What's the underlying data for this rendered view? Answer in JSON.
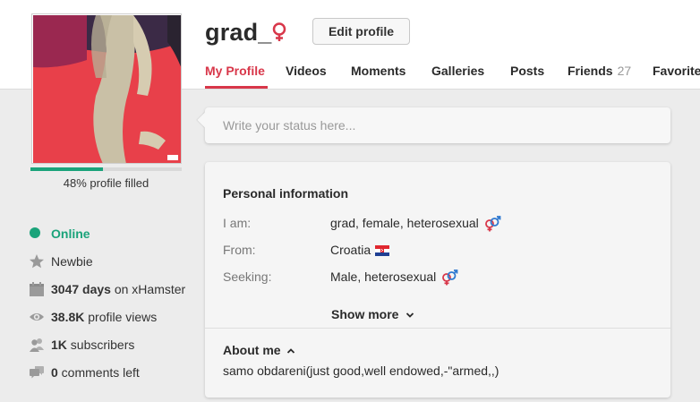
{
  "profile": {
    "username": "grad_",
    "edit_label": "Edit profile",
    "progress_percent": 48,
    "progress_label": "48% profile filled",
    "accent_color": "#d8374a",
    "online_color": "#1aa37a"
  },
  "tabs": [
    {
      "label": "My Profile",
      "active": true
    },
    {
      "label": "Videos"
    },
    {
      "label": "Moments"
    },
    {
      "label": "Galleries"
    },
    {
      "label": "Posts"
    },
    {
      "label": "Friends",
      "count": "27"
    },
    {
      "label": "Favorites"
    }
  ],
  "status": {
    "placeholder": "Write your status here..."
  },
  "personal": {
    "title": "Personal information",
    "rows": [
      {
        "label": "I am:",
        "value": "grad, female, heterosexual",
        "icon": "heterosexual-icon"
      },
      {
        "label": "From:",
        "value": "Croatia",
        "icon": "croatia-flag-icon"
      },
      {
        "label": "Seeking:",
        "value": "Male, heterosexual",
        "icon": "heterosexual-icon"
      }
    ],
    "show_more": "Show more"
  },
  "about": {
    "title": "About me",
    "text": "samo obdareni(just good,well endowed,-\"armed,,)"
  },
  "stats": {
    "online": "Online",
    "rank": "Newbie",
    "days_value": "3047 days",
    "days_suffix": " on xHamster",
    "views_value": "38.8K",
    "views_suffix": " profile views",
    "subs_value": "1K",
    "subs_suffix": " subscribers",
    "comments_value": "0",
    "comments_suffix": " comments left"
  }
}
